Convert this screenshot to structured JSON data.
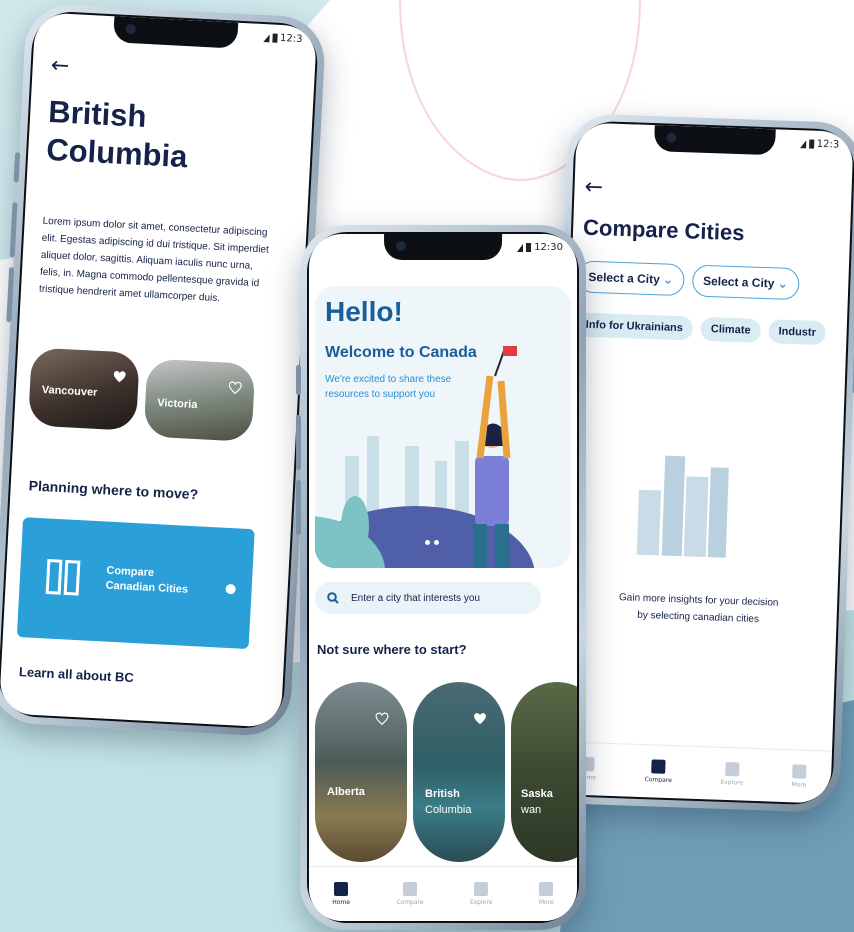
{
  "colors": {
    "navy": "#15224a",
    "accent_blue": "#2a9fd8",
    "pill_bg": "#d9ebf3",
    "teal_bg": "#bfe3e6"
  },
  "status": {
    "time_1": "12:3",
    "time_2": "12:30",
    "time_3": "12:3"
  },
  "bc_screen": {
    "title_line1": "British",
    "title_line2": "Columbia",
    "body": "Lorem ipsum dolor sit amet, consectetur adipiscing elit. Egestas adipiscing id dui tristique. Sit imperdiet aliquet dolor, sagittis. Aliquam iaculis nunc urna, felis, in. Magna commodo pellentesque gravida id tristique hendrerit amet ullamcorper duis.",
    "cities": [
      {
        "name": "Vancouver"
      },
      {
        "name": "Victoria"
      }
    ],
    "planning_heading": "Planning where to move?",
    "compare_card_line1": "Compare",
    "compare_card_line2": "Canadian Cities",
    "learn_heading": "Learn all about BC"
  },
  "home_screen": {
    "hello": "Hello!",
    "welcome": "Welcome to Canada",
    "subtitle": "We're excited to share these resources to support you",
    "search_placeholder": "Enter a city that interests you",
    "not_sure": "Not sure where to start?",
    "provinces": [
      {
        "name": "Alberta"
      },
      {
        "name_line1": "British",
        "name_line2": "Columbia"
      },
      {
        "name_line1": "Saska",
        "name_line2": "wan"
      }
    ],
    "tabs": [
      {
        "label": "Home"
      },
      {
        "label": "Compare"
      },
      {
        "label": "Explore"
      },
      {
        "label": "More"
      }
    ]
  },
  "compare_screen": {
    "title": "Compare Cities",
    "select_1": "Select a City",
    "select_2": "Select a City",
    "chips": [
      "Info for Ukrainians",
      "Climate",
      "Industr"
    ],
    "empty_line1": "Gain more insights for your decision",
    "empty_line2": "by selecting canadian cities",
    "tabs": [
      {
        "label": "Home"
      },
      {
        "label": "Compare"
      },
      {
        "label": "Explore"
      },
      {
        "label": "More"
      }
    ]
  }
}
